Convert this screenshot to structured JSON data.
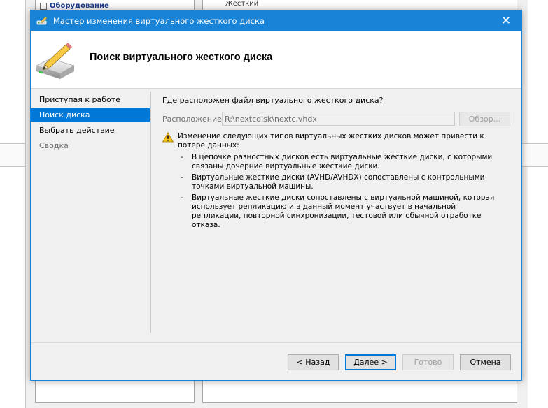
{
  "background": {
    "tree_item_label": "Оборудование",
    "right_pane_text": "Жесткий"
  },
  "dialog": {
    "title": "Мастер изменения виртуального жесткого диска",
    "page_title": "Поиск виртуального жесткого диска",
    "nav": [
      {
        "label": "Приступая к работе",
        "state": "normal"
      },
      {
        "label": "Поиск диска",
        "state": "active"
      },
      {
        "label": "Выбрать действие",
        "state": "normal"
      },
      {
        "label": "Сводка",
        "state": "disabled"
      }
    ],
    "question": "Где расположен файл виртуального жесткого диска?",
    "location_label": "Расположение:",
    "location_value": "R:\\nextcdisk\\nextc.vhdx",
    "browse_label": "Обзор...",
    "warning_intro": "Изменение следующих типов виртуальных жестких дисков может привести к потере данных:",
    "warning_items": [
      "В цепочке разностных дисков есть виртуальные жесткие диски, с которыми связаны дочерние виртуальные жесткие диски.",
      "Виртуальные жесткие диски (AVHD/AVHDX) сопоставлены с контрольными точками виртуальной машины.",
      "Виртуальные жесткие диски сопоставлены с виртуальной машиной, которая использует репликацию и в данный момент участвует в начальной репликации, повторной синхронизации, тестовой или обычной отработке отказа."
    ],
    "dash": "-",
    "buttons": {
      "back": "< Назад",
      "next": "Далее >",
      "finish": "Готово",
      "cancel": "Отмена"
    },
    "close_glyph": "✕"
  },
  "colors": {
    "titlebar": "#1883d7",
    "nav_active": "#0078d7",
    "dialog_bg": "#f0f0f0"
  },
  "icons": [
    "wizard-app-icon",
    "close-icon",
    "disk-edit-icon",
    "warning-icon"
  ]
}
